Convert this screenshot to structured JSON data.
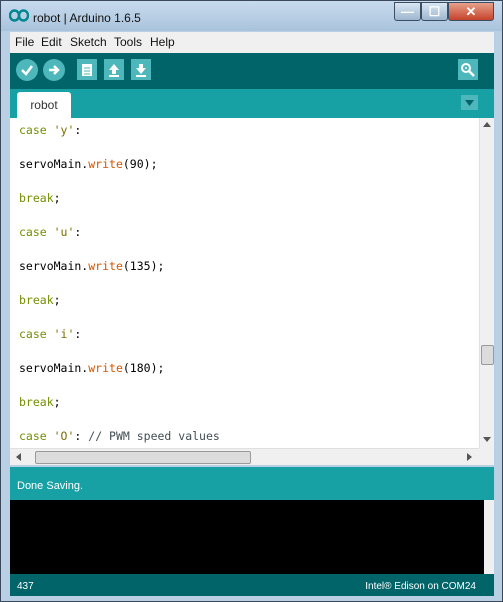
{
  "window": {
    "title": "robot | Arduino 1.6.5",
    "minimize_glyph": "—",
    "maximize_glyph": "☐",
    "close_glyph": "✕"
  },
  "menu": [
    "File",
    "Edit",
    "Sketch",
    "Tools",
    "Help"
  ],
  "toolbar": {
    "icons": [
      "verify-icon",
      "upload-icon",
      "new-icon",
      "open-icon",
      "save-icon",
      "serial-monitor-icon"
    ]
  },
  "tabs": [
    {
      "label": "robot"
    }
  ],
  "code": {
    "lines": [
      [
        {
          "t": "case ",
          "c": "kw"
        },
        {
          "t": "'y'",
          "c": "str"
        },
        {
          "t": ":",
          "c": ""
        }
      ],
      [
        {
          "t": "servoMain.",
          "c": ""
        },
        {
          "t": "write",
          "c": "fn"
        },
        {
          "t": "(90);",
          "c": ""
        }
      ],
      [
        {
          "t": "break",
          "c": "kw"
        },
        {
          "t": ";",
          "c": ""
        }
      ],
      [
        {
          "t": "case ",
          "c": "kw"
        },
        {
          "t": "'u'",
          "c": "str"
        },
        {
          "t": ":",
          "c": ""
        }
      ],
      [
        {
          "t": "servoMain.",
          "c": ""
        },
        {
          "t": "write",
          "c": "fn"
        },
        {
          "t": "(135);",
          "c": ""
        }
      ],
      [
        {
          "t": "break",
          "c": "kw"
        },
        {
          "t": ";",
          "c": ""
        }
      ],
      [
        {
          "t": "case ",
          "c": "kw"
        },
        {
          "t": "'i'",
          "c": "str"
        },
        {
          "t": ":",
          "c": ""
        }
      ],
      [
        {
          "t": "servoMain.",
          "c": ""
        },
        {
          "t": "write",
          "c": "fn"
        },
        {
          "t": "(180);",
          "c": ""
        }
      ],
      [
        {
          "t": "break",
          "c": "kw"
        },
        {
          "t": ";",
          "c": ""
        }
      ],
      [
        {
          "t": "case ",
          "c": "kw"
        },
        {
          "t": "'O'",
          "c": "str"
        },
        {
          "t": ": ",
          "c": ""
        },
        {
          "t": "// PWM speed values",
          "c": "cmt"
        }
      ]
    ]
  },
  "status": {
    "message": "Done Saving."
  },
  "footer": {
    "line": "437",
    "board": "Intel® Edison on COM24"
  },
  "colors": {
    "toolbar": "#006468",
    "tabbar": "#17a1a5",
    "button": "#4db7bb"
  }
}
